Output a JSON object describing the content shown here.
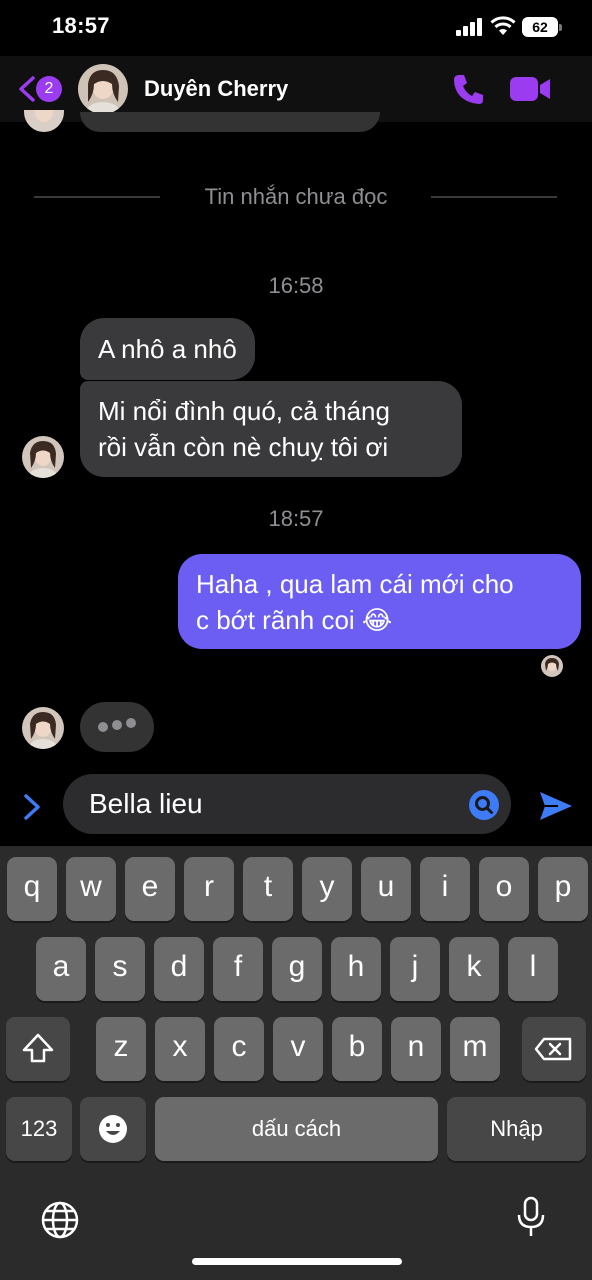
{
  "status_bar": {
    "time": "18:57",
    "battery": "62"
  },
  "header": {
    "back_badge": "2",
    "contact_name": "Duyên Cherry"
  },
  "chat": {
    "unread_divider": "Tin nhắn chưa đọc",
    "timestamp_1": "16:58",
    "incoming_1": "A nhô a nhô",
    "incoming_2_line1": "Mi nổi đình quó, cả tháng",
    "incoming_2_line2": "rồi vẫn còn nè chuỵ tôi ơi",
    "timestamp_2": "18:57",
    "outgoing_line1": "Haha , qua lam cái mới cho",
    "outgoing_line2": "c bớt rãnh coi 😂"
  },
  "composer": {
    "value": "Bella lieu"
  },
  "keyboard": {
    "row1": [
      "q",
      "w",
      "e",
      "r",
      "t",
      "y",
      "u",
      "i",
      "o",
      "p"
    ],
    "row2": [
      "a",
      "s",
      "d",
      "f",
      "g",
      "h",
      "j",
      "k",
      "l"
    ],
    "row3": [
      "z",
      "x",
      "c",
      "v",
      "b",
      "n",
      "m"
    ],
    "numbers_key": "123",
    "space_key": "dấu cách",
    "return_key": "Nhập"
  },
  "colors": {
    "accent": "#9b3cf0",
    "outgoing_bubble": "#6c5ef2",
    "incoming_bubble": "#3a3a3c",
    "send": "#3d7bf7"
  },
  "icons": [
    "back-chevron-icon",
    "phone-icon",
    "video-camera-icon",
    "expand-chevron-icon",
    "search-icon",
    "send-icon",
    "shift-icon",
    "backspace-icon",
    "emoji-icon",
    "globe-icon",
    "microphone-icon"
  ]
}
